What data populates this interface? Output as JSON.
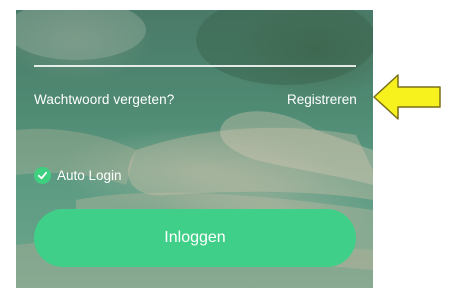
{
  "login": {
    "password_field_value": "",
    "forgot_password_label": "Wachtwoord vergeten?",
    "register_label": "Registreren",
    "auto_login_label": "Auto Login",
    "auto_login_checked": true,
    "login_button_label": "Inloggen"
  },
  "annotation": {
    "arrow_icon": "yellow-arrow-left-icon",
    "arrow_color": "#f7f21d"
  },
  "colors": {
    "accent": "#3fcf88",
    "checkbox": "#3ecf7f"
  }
}
